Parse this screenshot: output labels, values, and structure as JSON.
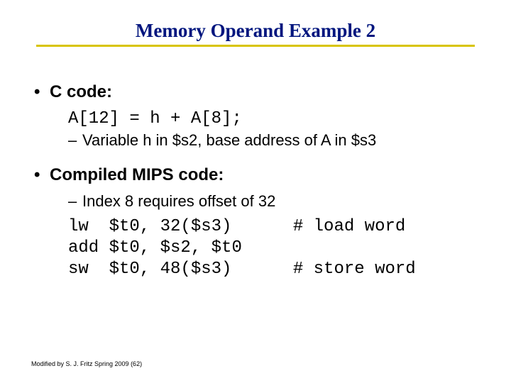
{
  "title": "Memory Operand Example 2",
  "section1": {
    "heading": "C code:",
    "code": "A[12] = h + A[8];",
    "sub": "Variable h in $s2, base address of A in $s3"
  },
  "section2": {
    "heading": "Compiled MIPS code:",
    "sub": "Index 8 requires offset of 32",
    "mips": "lw  $t0, 32($s3)      # load word\nadd $t0, $s2, $t0\nsw  $t0, 48($s3)      # store word"
  },
  "footer": "Modified by S. J. Fritz Spring 2009 (62)"
}
